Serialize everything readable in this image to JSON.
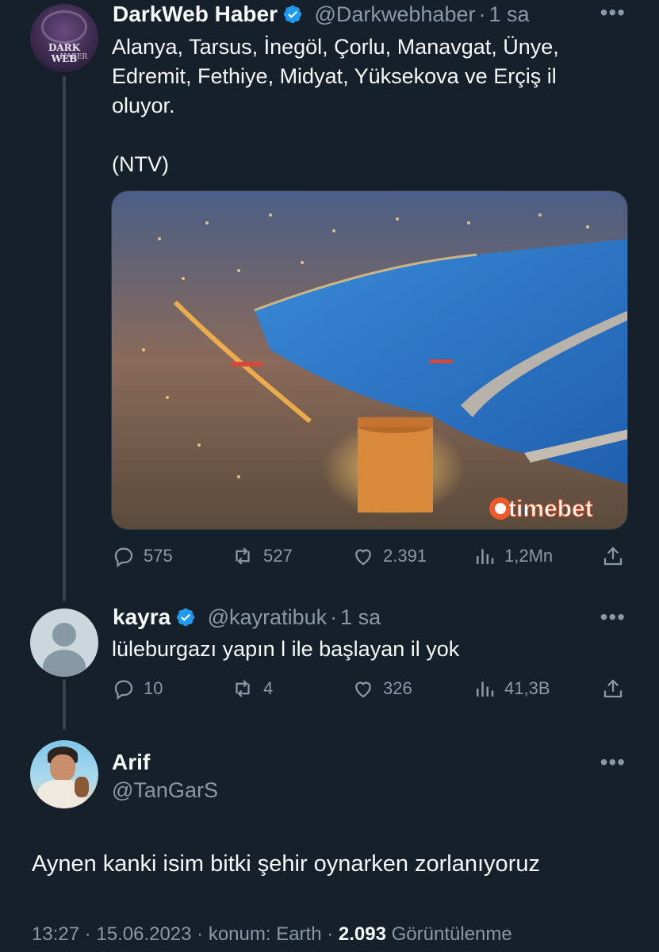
{
  "tweet1": {
    "author_name": "DarkWeb Haber",
    "handle": "@Darkwebhaber",
    "time": "1 sa",
    "avatar_text_line1": "DARK WEB",
    "avatar_text_line2": "HABER",
    "text_line1": "Alanya, Tarsus, İnegöl, Çorlu, Manavgat, Ünye,",
    "text_line2": "Edremit, Fethiye, Midyat, Yüksekova ve Erçiş il",
    "text_line3": "oluyor.",
    "text_line4": "(NTV)",
    "media_watermark": "timebet",
    "replies": "575",
    "retweets": "527",
    "likes": "2.391",
    "views": "1,2Mn"
  },
  "tweet2": {
    "author_name": "kayra",
    "handle": "@kayratibuk",
    "time": "1 sa",
    "text": "lüleburgazı yapın l ile başlayan il yok",
    "replies": "10",
    "retweets": "4",
    "likes": "326",
    "views": "41,3B"
  },
  "tweet3": {
    "author_name": "Arif",
    "handle": "@TanGarS",
    "text": "Aynen kanki isim bitki şehir oynarken zorlanıyoruz",
    "timestamp": "13:27 · 15.06.2023 · konum: Earth · ",
    "view_count": "2.093",
    "view_label": "Görüntülenme"
  },
  "ui": {
    "separator": "·",
    "more_icon": "more-horizontal-icon",
    "accent": "#1d9bf0",
    "background": "#15202b",
    "muted": "#8b98a5"
  }
}
